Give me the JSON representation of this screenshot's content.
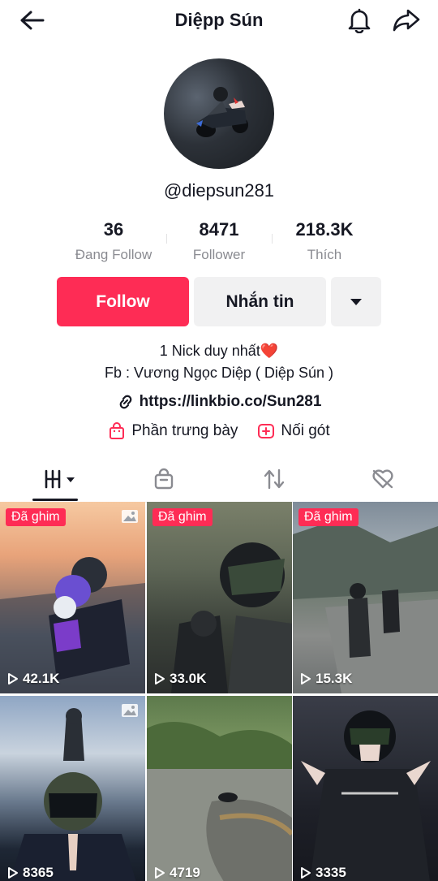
{
  "header": {
    "title": "Diệpp Sún"
  },
  "profile": {
    "username": "@diepsun281"
  },
  "stats": [
    {
      "value": "36",
      "label": "Đang Follow"
    },
    {
      "value": "8471",
      "label": "Follower"
    },
    {
      "value": "218.3K",
      "label": "Thích"
    }
  ],
  "buttons": {
    "follow": "Follow",
    "message": "Nhắn tin"
  },
  "bio": {
    "line1": "1 Nick duy nhất❤️",
    "line2": "Fb : Vương Ngọc Diệp ( Diệp Sún )",
    "link": "https://linkbio.co/Sun281"
  },
  "extras": {
    "showcase": "Phần trưng bày",
    "duet": "Nối gót"
  },
  "videos": [
    {
      "pinned": "Đã ghim",
      "views": "42.1K"
    },
    {
      "pinned": "Đã ghim",
      "views": "33.0K"
    },
    {
      "pinned": "Đã ghim",
      "views": "15.3K"
    },
    {
      "views": "8365"
    },
    {
      "views": "4719"
    },
    {
      "views": "3335"
    }
  ],
  "colors": {
    "accent": "#fe2c55",
    "text": "#161823",
    "muted": "#8a8b91",
    "button_bg": "#f1f1f2"
  }
}
